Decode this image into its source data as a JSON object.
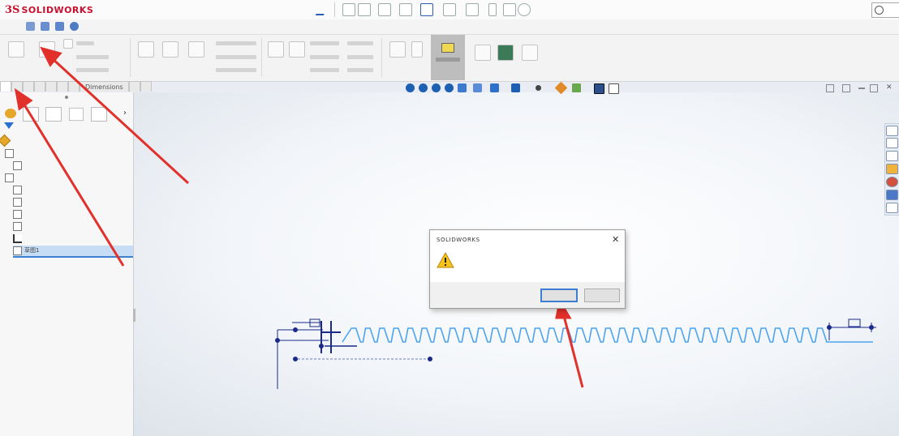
{
  "app": {
    "brand_prefix": "3S",
    "brand_name": "SOLIDWORKS"
  },
  "menu": {
    "items": [
      "",
      "",
      "",
      "",
      "",
      "",
      ""
    ]
  },
  "feature_tabs": [
    "",
    "",
    "",
    "",
    "",
    "",
    "",
    "",
    "Dimensions",
    "",
    ""
  ],
  "feature_tree": {
    "items": [
      {
        "label": ""
      },
      {
        "label": ""
      },
      {
        "label": ""
      },
      {
        "label": ""
      },
      {
        "label": ""
      },
      {
        "label": ""
      },
      {
        "label": ""
      },
      {
        "label": ""
      },
      {
        "label": ""
      },
      {
        "label": "草图1",
        "selected": true
      }
    ]
  },
  "dialog": {
    "title": "SOLIDWORKS",
    "message_line1": "",
    "message_line2": "",
    "ok_label": "",
    "cancel_label": ""
  },
  "sketch": {
    "dimension_top_left": "",
    "dimension_vertical": "",
    "dimension_right": "",
    "thread_count": 34
  },
  "colors": {
    "accent": "#3c7fd1",
    "brand": "#c8102e",
    "sketch": "#4aa3f0",
    "dimension": "#1a2a8a",
    "annotation_arrow": "#e2302a"
  }
}
